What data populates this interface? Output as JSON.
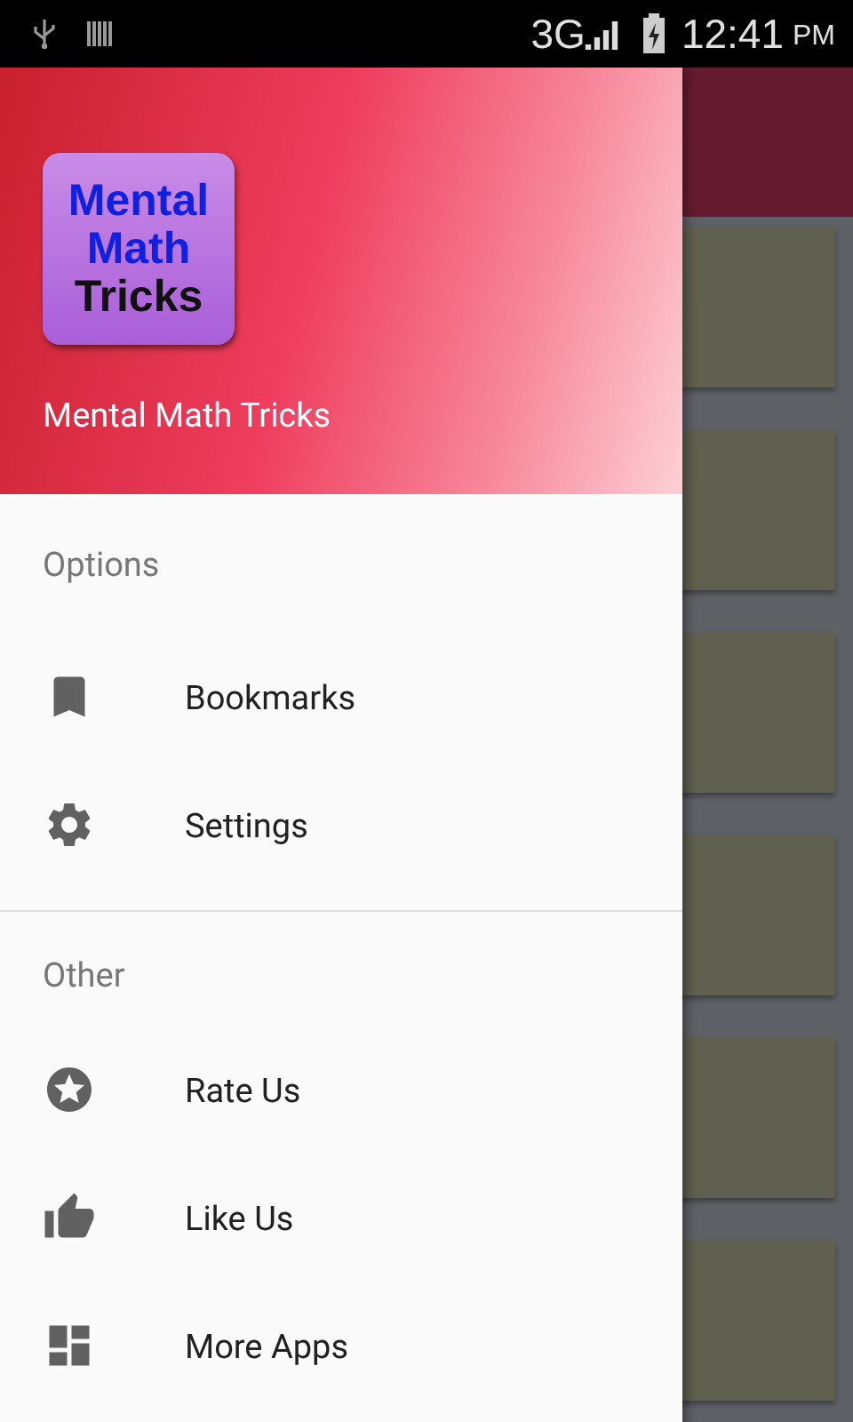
{
  "status_bar": {
    "network": "3G",
    "time": "12:41",
    "period": "PM"
  },
  "drawer": {
    "logo_lines": [
      "Mental",
      "Math",
      "Tricks"
    ],
    "app_name": "Mental Math Tricks",
    "sections": [
      {
        "title": "Options",
        "items": [
          {
            "label": "Bookmarks"
          },
          {
            "label": "Settings"
          }
        ]
      },
      {
        "title": "Other",
        "items": [
          {
            "label": "Rate Us"
          },
          {
            "label": "Like Us"
          },
          {
            "label": "More Apps"
          }
        ]
      }
    ]
  }
}
